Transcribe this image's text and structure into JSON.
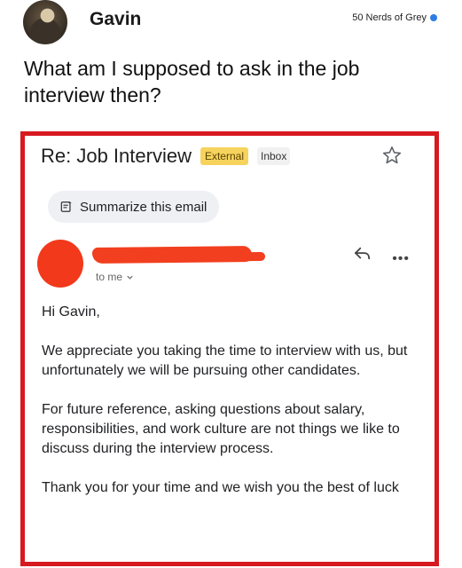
{
  "post": {
    "author": "Gavin",
    "source": "50 Nerds of Grey",
    "question": "What am I supposed to ask in the job interview then?"
  },
  "email": {
    "subject": "Re: Job Interview",
    "badges": {
      "external": "External",
      "inbox": "Inbox"
    },
    "summarize_label": "Summarize this email",
    "to_label": "to me",
    "body": {
      "greeting": "Hi Gavin,",
      "paragraph1": "We appreciate you taking the time to interview with us, but unfortunately we will be pursuing other candidates.",
      "paragraph2": "For future reference, asking questions about salary, responsibilities, and work culture are not things we like to discuss during the interview process.",
      "paragraph3": "Thank you for your time and we wish you the best of luck"
    }
  },
  "icons": {
    "verified": "verified-icon",
    "star": "star-icon",
    "summarize": "summarize-icon",
    "reply": "reply-icon",
    "more": "more-icon",
    "chevron": "chevron-down-icon"
  },
  "colors": {
    "frame": "#d71920",
    "external_badge": "#f6d35d",
    "redaction": "#f23f1f",
    "verified": "#2f7de1"
  }
}
